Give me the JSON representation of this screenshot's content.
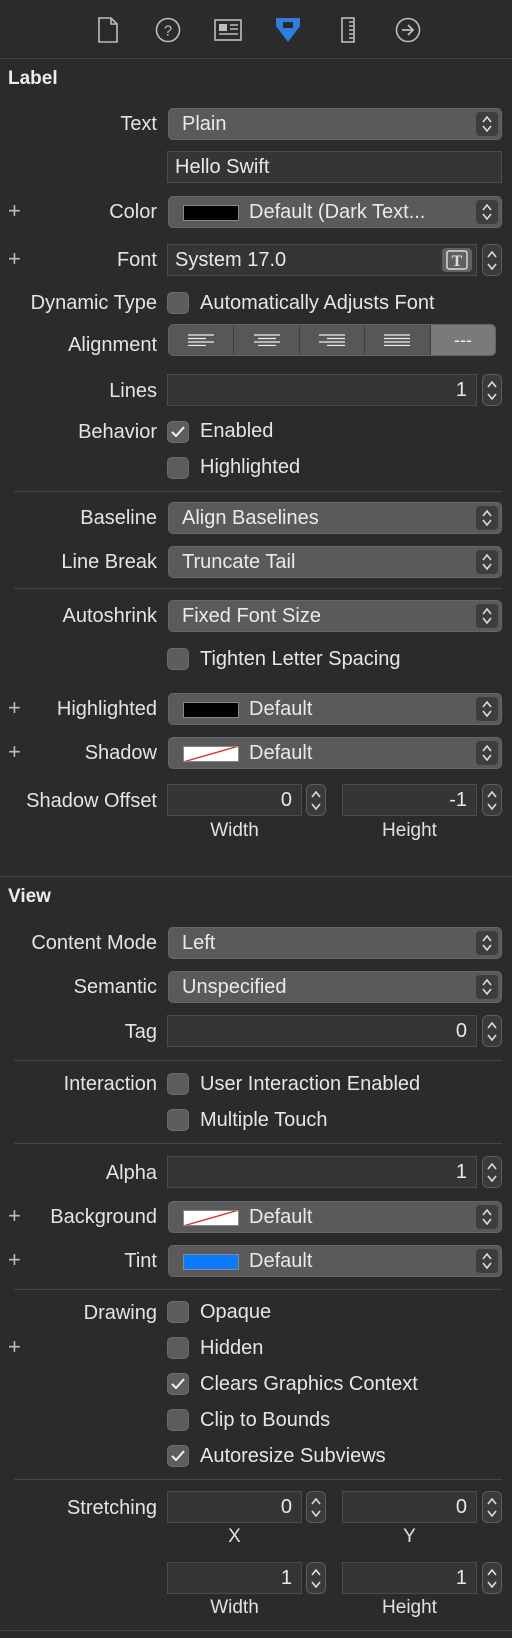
{
  "toolbar": {
    "icons": [
      "file-icon",
      "help-icon",
      "identity-icon",
      "attributes-icon",
      "size-icon",
      "connections-icon"
    ]
  },
  "label_section": {
    "title": "Label",
    "text": {
      "label": "Text",
      "value": "Plain",
      "content": "Hello Swift"
    },
    "color": {
      "label": "Color",
      "value": "Default (Dark Text...",
      "swatch": "#000000"
    },
    "font": {
      "label": "Font",
      "value": "System 17.0"
    },
    "dynamic_type": {
      "label": "Dynamic Type",
      "option": "Automatically Adjusts Font",
      "checked": false
    },
    "alignment": {
      "label": "Alignment",
      "selected": "---"
    },
    "lines": {
      "label": "Lines",
      "value": "1"
    },
    "behavior": {
      "label": "Behavior",
      "enabled": "Enabled",
      "enabled_checked": true,
      "highlighted": "Highlighted",
      "highlighted_checked": false
    },
    "baseline": {
      "label": "Baseline",
      "value": "Align Baselines"
    },
    "line_break": {
      "label": "Line Break",
      "value": "Truncate Tail"
    },
    "autoshrink": {
      "label": "Autoshrink",
      "value": "Fixed Font Size",
      "tighten": "Tighten Letter Spacing",
      "tighten_checked": false
    },
    "highlighted_color": {
      "label": "Highlighted",
      "value": "Default",
      "swatch": "#000000"
    },
    "shadow": {
      "label": "Shadow",
      "value": "Default"
    },
    "shadow_offset": {
      "label": "Shadow Offset",
      "width": "0",
      "height": "-1",
      "width_label": "Width",
      "height_label": "Height"
    }
  },
  "view_section": {
    "title": "View",
    "content_mode": {
      "label": "Content Mode",
      "value": "Left"
    },
    "semantic": {
      "label": "Semantic",
      "value": "Unspecified"
    },
    "tag": {
      "label": "Tag",
      "value": "0"
    },
    "interaction": {
      "label": "Interaction",
      "user_interaction": "User Interaction Enabled",
      "user_interaction_checked": false,
      "multiple_touch": "Multiple Touch",
      "multiple_touch_checked": false
    },
    "alpha": {
      "label": "Alpha",
      "value": "1"
    },
    "background": {
      "label": "Background",
      "value": "Default"
    },
    "tint": {
      "label": "Tint",
      "value": "Default",
      "swatch": "#0a7aff"
    },
    "drawing": {
      "label": "Drawing",
      "opaque": "Opaque",
      "opaque_checked": false,
      "hidden": "Hidden",
      "hidden_checked": false,
      "clears": "Clears Graphics Context",
      "clears_checked": true,
      "clip": "Clip to Bounds",
      "clip_checked": false,
      "autoresize": "Autoresize Subviews",
      "autoresize_checked": true
    },
    "stretching": {
      "label": "Stretching",
      "x": "0",
      "y": "0",
      "x_label": "X",
      "y_label": "Y",
      "width": "1",
      "height": "1",
      "width_label": "Width",
      "height_label": "Height"
    }
  },
  "colors": {
    "accent": "#2f7de1",
    "background": "#2b2b2b",
    "popup": "#5a5a5a"
  }
}
